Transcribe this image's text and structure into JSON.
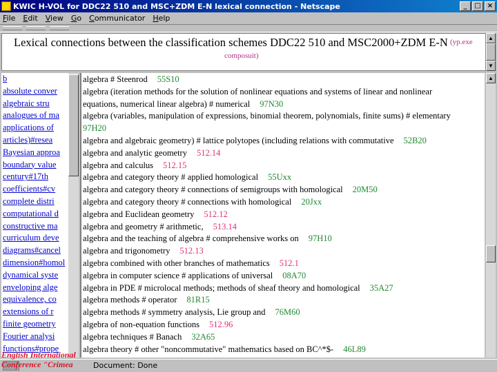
{
  "window": {
    "title": "KWIC H-VOL for DDC22 510 and MSC+ZDM E-N lexical connection - Netscape",
    "buttons": {
      "minimize": "_",
      "maximize": "□",
      "close": "×"
    }
  },
  "menu": [
    "File",
    "Edit",
    "View",
    "Go",
    "Communicator",
    "Help"
  ],
  "header": {
    "title": "Lexical connections between the classification schemes DDC22 510 and MSC2000+ZDM E-N",
    "link1": "(yp.exe",
    "link2": "composuit)"
  },
  "left_list": [
    "b",
    "absolute conver",
    "algebraic stru",
    "analogues of ma",
    "applications of",
    "articles)#resea",
    "Bayesian approa",
    "boundary value",
    "century#17th",
    "coefficients#cv",
    "complete distri",
    "computational d",
    "constructive ma",
    "curriculum deve",
    "diagrams#cancel",
    "dimension#homol",
    "dynamical syste",
    "enveloping alge",
    "equivalence, co",
    "extensions of r",
    "finite geometry",
    "Fourier analysi",
    "functions#prope"
  ],
  "main_list": [
    {
      "text": "algebra # Steenrod",
      "code": "55S10",
      "color": "green"
    },
    {
      "text": "algebra (iteration methods for the solution of nonlinear equations and systems of linear and nonlinear",
      "code": "",
      "color": ""
    },
    {
      "text": "equations, numerical linear algebra) # numerical",
      "code": "97N30",
      "color": "green"
    },
    {
      "text": "algebra (variables, manipulation of expressions, binomial theorem, polynomials, finite sums) # elementary",
      "code": "",
      "color": ""
    },
    {
      "text": "",
      "code": "97H20",
      "color": "green"
    },
    {
      "text": "algebra and algebraic geometry) # lattice polytopes (including relations with commutative",
      "code": "52B20",
      "color": "green"
    },
    {
      "text": "algebra and analytic geometry",
      "code": "512.14",
      "color": "pink"
    },
    {
      "text": "algebra and calculus",
      "code": "512.15",
      "color": "pink"
    },
    {
      "text": "algebra and category theory # applied homological",
      "code": "55Uxx",
      "color": "green"
    },
    {
      "text": "algebra and category theory # connections of semigroups with homological",
      "code": "20M50",
      "color": "green"
    },
    {
      "text": "algebra and category theory # connections with homological",
      "code": "20Jxx",
      "color": "green"
    },
    {
      "text": "algebra and Euclidean geometry",
      "code": "512.12",
      "color": "pink"
    },
    {
      "text": "algebra and geometry # arithmetic,",
      "code": "513.14",
      "color": "pink"
    },
    {
      "text": "algebra and the teaching of algebra # comprehensive works on",
      "code": "97H10",
      "color": "green"
    },
    {
      "text": "algebra and trigonometry",
      "code": "512.13",
      "color": "pink"
    },
    {
      "text": "algebra combined with other branches of mathematics",
      "code": "512.1",
      "color": "pink"
    },
    {
      "text": "algebra in computer science # applications of universal",
      "code": "08A70",
      "color": "green"
    },
    {
      "text": "algebra in PDE # microlocal methods; methods of sheaf theory and homological",
      "code": "35A27",
      "color": "green"
    },
    {
      "text": "algebra methods # operator",
      "code": "81R15",
      "color": "green"
    },
    {
      "text": "algebra methods # symmetry analysis, Lie group and",
      "code": "76M60",
      "color": "green"
    },
    {
      "text": "algebra of non-equation functions",
      "code": "512.96",
      "color": "pink"
    },
    {
      "text": "algebra techniques # Banach",
      "code": "32A65",
      "color": "green"
    },
    {
      "text": "algebra theory # other \"noncommutative\" mathematics based on BC^*$-",
      "code": "46L89",
      "color": "green"
    }
  ],
  "status": {
    "text": "Document: Done"
  },
  "overlay": "English International Conference \"Crimea"
}
